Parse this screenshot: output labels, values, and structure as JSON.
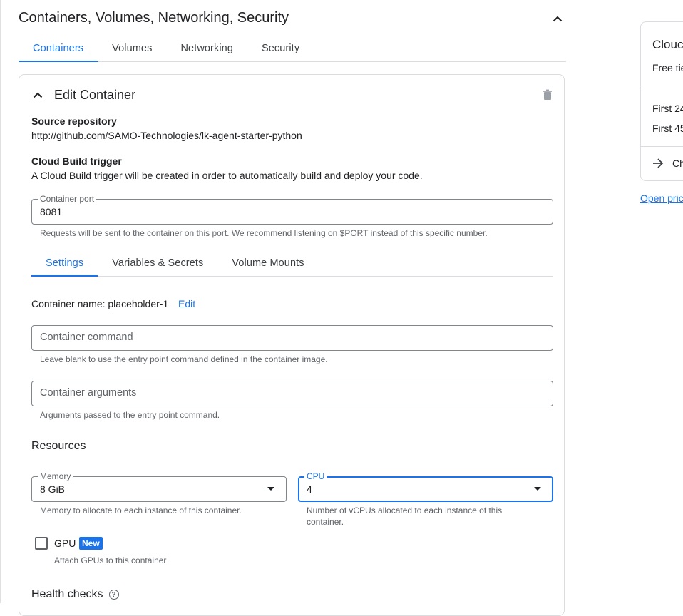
{
  "section": {
    "title": "Containers, Volumes, Networking, Security"
  },
  "top_tabs": [
    {
      "label": "Containers"
    },
    {
      "label": "Volumes"
    },
    {
      "label": "Networking"
    },
    {
      "label": "Security"
    }
  ],
  "edit_container": {
    "title": "Edit Container",
    "source_repo_label": "Source repository",
    "source_repo_value": "http://github.com/SAMO-Technologies/lk-agent-starter-python",
    "trigger_label": "Cloud Build trigger",
    "trigger_text": "A Cloud Build trigger will be created in order to automatically build and deploy your code.",
    "port_label": "Container port",
    "port_value": "8081",
    "port_hint": "Requests will be sent to the container on this port. We recommend listening on $PORT instead of this specific number."
  },
  "inner_tabs": [
    {
      "label": "Settings"
    },
    {
      "label": "Variables & Secrets"
    },
    {
      "label": "Volume Mounts"
    }
  ],
  "settings": {
    "container_name_text": "Container name: placeholder-1",
    "edit_link": "Edit",
    "command_placeholder": "Container command",
    "command_hint": "Leave blank to use the entry point command defined in the container image.",
    "args_placeholder": "Container arguments",
    "args_hint": "Arguments passed to the entry point command."
  },
  "resources": {
    "title": "Resources",
    "memory_label": "Memory",
    "memory_value": "8 GiB",
    "memory_hint": "Memory to allocate to each instance of this container.",
    "cpu_label": "CPU",
    "cpu_value": "4",
    "cpu_hint_line1": "Number of vCPUs allocated to each instance of this",
    "cpu_hint_line2": "container.",
    "gpu_label": "GPU",
    "gpu_badge": "New",
    "gpu_hint": "Attach GPUs to this container"
  },
  "health": {
    "title": "Health checks"
  },
  "side_panel": {
    "title": "Clouc",
    "subtitle": "Free tie",
    "line1": "First 24",
    "line2": "First 45",
    "action": "Ch",
    "link": "Open pric"
  },
  "colors": {
    "accent": "#1a73e8",
    "border": "#dadce0",
    "text": "#202124",
    "muted": "#5f6368"
  }
}
